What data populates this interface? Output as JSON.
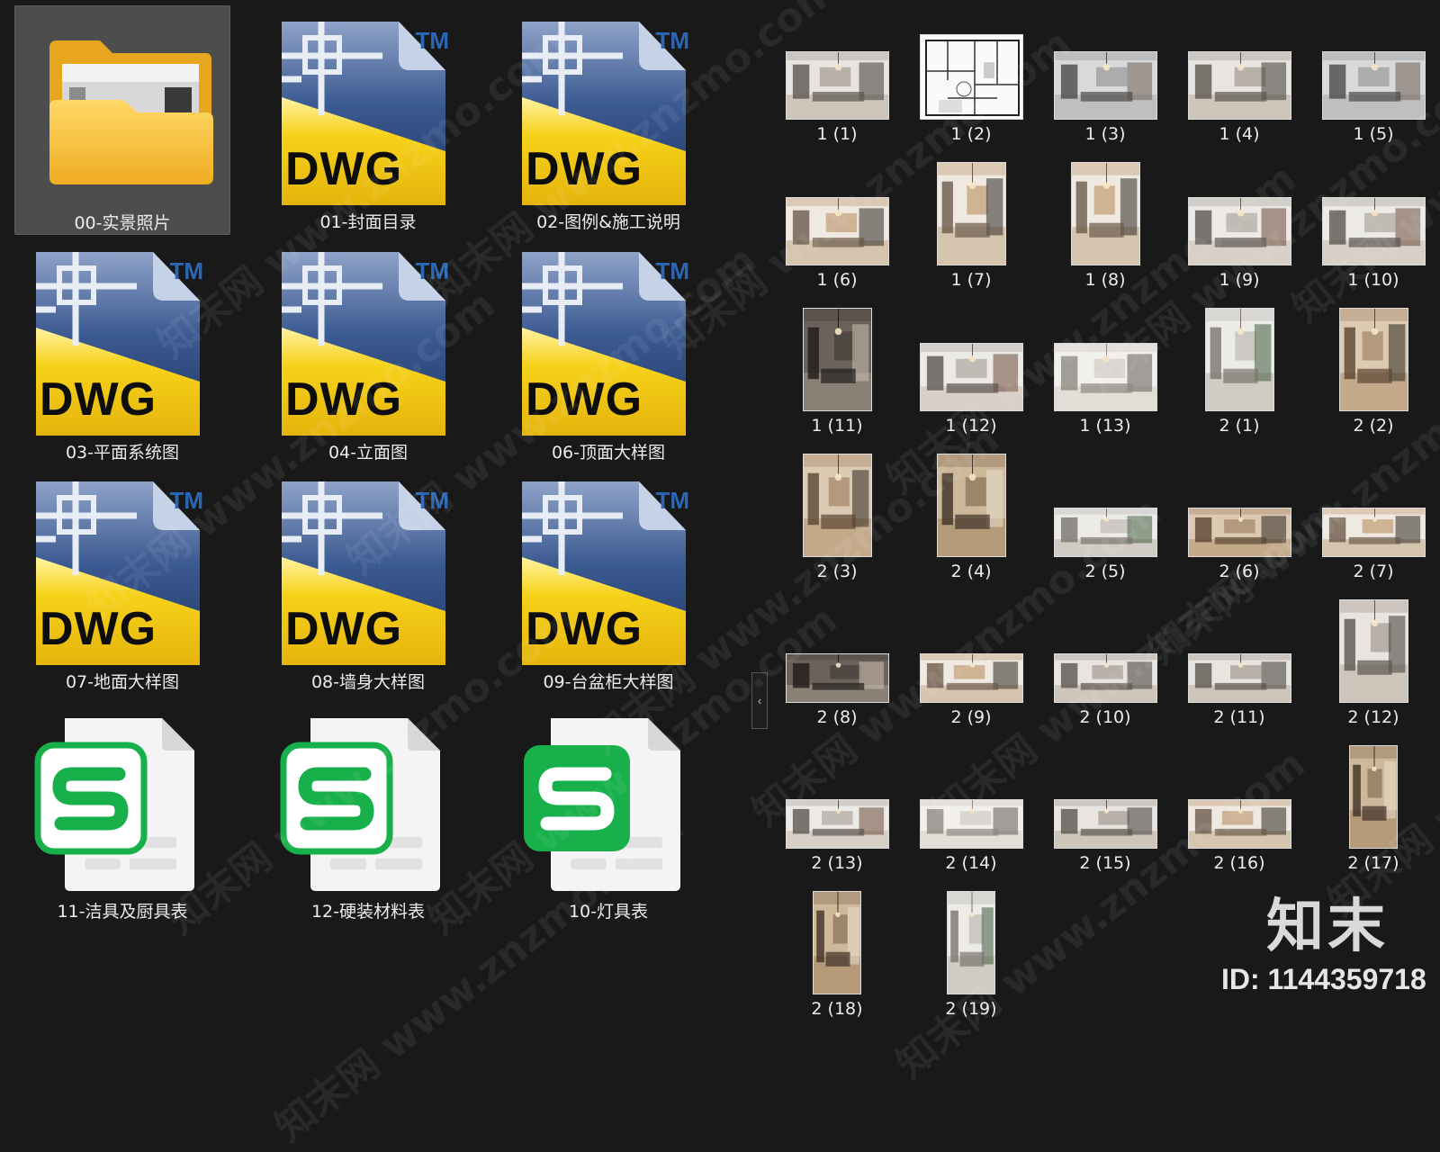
{
  "left_pane": {
    "files": [
      {
        "name": "00-实景照片",
        "type": "folder",
        "selected": true
      },
      {
        "name": "01-封面目录",
        "type": "dwg"
      },
      {
        "name": "02-图例&施工说明",
        "type": "dwg"
      },
      {
        "name": "03-平面系统图",
        "type": "dwg"
      },
      {
        "name": "04-立面图",
        "type": "dwg"
      },
      {
        "name": "06-顶面大样图",
        "type": "dwg"
      },
      {
        "name": "07-地面大样图",
        "type": "dwg"
      },
      {
        "name": "08-墙身大样图",
        "type": "dwg"
      },
      {
        "name": "09-台盆柜大样图",
        "type": "dwg"
      },
      {
        "name": "11-洁具及厨具表",
        "type": "sheet"
      },
      {
        "name": "12-硬装材料表",
        "type": "sheet"
      },
      {
        "name": "10-灯具表",
        "type": "sheet_filled"
      }
    ],
    "dwg_badge": "DWG",
    "trademark": "TM",
    "sheet_glyph": "S"
  },
  "right_pane": {
    "thumbnails": [
      {
        "label": "1 (1)",
        "orientation": "landscape",
        "tone": "living"
      },
      {
        "label": "1 (2)",
        "orientation": "square",
        "tone": "plan"
      },
      {
        "label": "1 (3)",
        "orientation": "landscape",
        "tone": "marble"
      },
      {
        "label": "1 (4)",
        "orientation": "landscape",
        "tone": "living"
      },
      {
        "label": "1 (5)",
        "orientation": "landscape",
        "tone": "marble"
      },
      {
        "label": "1 (6)",
        "orientation": "landscape",
        "tone": "dining"
      },
      {
        "label": "1 (7)",
        "orientation": "portrait",
        "tone": "dining"
      },
      {
        "label": "1 (8)",
        "orientation": "portrait",
        "tone": "dining"
      },
      {
        "label": "1 (9)",
        "orientation": "landscape",
        "tone": "bedroom"
      },
      {
        "label": "1 (10)",
        "orientation": "landscape",
        "tone": "bedroom"
      },
      {
        "label": "1 (11)",
        "orientation": "portrait",
        "tone": "dark"
      },
      {
        "label": "1 (12)",
        "orientation": "landscape",
        "tone": "bedroom"
      },
      {
        "label": "1 (13)",
        "orientation": "landscape",
        "tone": "light"
      },
      {
        "label": "2 (1)",
        "orientation": "portrait",
        "tone": "kitchen"
      },
      {
        "label": "2 (2)",
        "orientation": "portrait",
        "tone": "wood"
      },
      {
        "label": "2 (3)",
        "orientation": "portrait",
        "tone": "wood"
      },
      {
        "label": "2 (4)",
        "orientation": "portrait",
        "tone": "wardrobe"
      },
      {
        "label": "2 (5)",
        "orientation": "wide",
        "tone": "kitchen"
      },
      {
        "label": "2 (6)",
        "orientation": "wide",
        "tone": "wood"
      },
      {
        "label": "2 (7)",
        "orientation": "wide",
        "tone": "dining"
      },
      {
        "label": "2 (8)",
        "orientation": "wide",
        "tone": "dark"
      },
      {
        "label": "2 (9)",
        "orientation": "wide",
        "tone": "dining"
      },
      {
        "label": "2 (10)",
        "orientation": "wide",
        "tone": "living"
      },
      {
        "label": "2 (11)",
        "orientation": "wide",
        "tone": "living"
      },
      {
        "label": "2 (12)",
        "orientation": "portrait",
        "tone": "living"
      },
      {
        "label": "2 (13)",
        "orientation": "wide",
        "tone": "bedroom"
      },
      {
        "label": "2 (14)",
        "orientation": "wide",
        "tone": "light"
      },
      {
        "label": "2 (15)",
        "orientation": "wide",
        "tone": "living"
      },
      {
        "label": "2 (16)",
        "orientation": "wide",
        "tone": "dining"
      },
      {
        "label": "2 (17)",
        "orientation": "tall",
        "tone": "wardrobe"
      },
      {
        "label": "2 (18)",
        "orientation": "tall",
        "tone": "wardrobe"
      },
      {
        "label": "2 (19)",
        "orientation": "tall",
        "tone": "kitchen"
      }
    ]
  },
  "collapse_glyph": "‹",
  "watermark": {
    "text_cn": "知末网",
    "url": "www.znzmo.com"
  },
  "brand": {
    "logo": "知末",
    "id_text": "ID: 1144359718"
  },
  "colors": {
    "background": "#191919",
    "selected": "#4d4d4d",
    "dwg_yellow": "#f2c516",
    "dwg_blue": "#2f4c82",
    "tm_blue": "#2a67b6",
    "sheet_green": "#17b04a",
    "folder_yellow": "#f8c53a"
  }
}
